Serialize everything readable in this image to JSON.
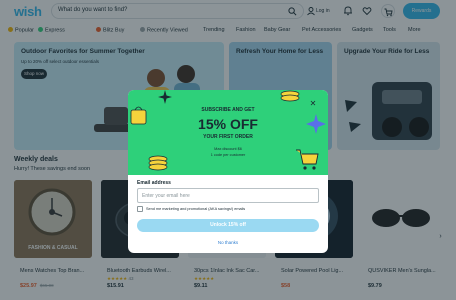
{
  "header": {
    "logo": "wish",
    "search_placeholder": "What do you want to find?",
    "login_label": "Log in",
    "wallet_label": "Rewards",
    "colors": {
      "brand": "#2fb7ec"
    }
  },
  "categories": [
    {
      "label": "Popular",
      "icon": "star-icon"
    },
    {
      "label": "Express",
      "icon": "lightning-icon"
    },
    {
      "label": "Blitz Buy",
      "icon": "flash-icon"
    },
    {
      "label": "Recently Viewed",
      "icon": "eye-icon"
    },
    {
      "label": "Trending",
      "icon": ""
    },
    {
      "label": "Fashion",
      "icon": ""
    },
    {
      "label": "Baby Gear",
      "icon": ""
    },
    {
      "label": "Pet Accessories",
      "icon": ""
    },
    {
      "label": "Gadgets",
      "icon": ""
    },
    {
      "label": "Tools",
      "icon": ""
    },
    {
      "label": "More",
      "icon": ""
    }
  ],
  "banners": [
    {
      "title": "Outdoor Favorites for Summer Together",
      "subtitle": "Up to 20% off select outdoor essentials",
      "button": "Shop now"
    },
    {
      "title": "Refresh Your Home for Less",
      "subtitle": "",
      "button": ""
    },
    {
      "title": "Upgrade Your Ride for Less",
      "subtitle": "",
      "button": ""
    }
  ],
  "weekly_deals": {
    "title": "Weekly deals",
    "subtitle": "Hurry! These savings end soon",
    "products": [
      {
        "name": "Mens Watches Top Bran...",
        "price": "$25.97",
        "old_price": "$65.00",
        "stars": "",
        "rating_count": "",
        "caption": "FASHION & CASUAL"
      },
      {
        "name": "Bluetooth Earbuds Wirel...",
        "price": "$15.91",
        "old_price": "",
        "stars": "★★★★★",
        "rating_count": "43",
        "caption": ""
      },
      {
        "name": "30pcs 1Inlac Ink Sac Car...",
        "price": "$9.11",
        "old_price": "",
        "stars": "★★★★★",
        "rating_count": "",
        "caption": ""
      },
      {
        "name": "Solar Powered Pool Lig...",
        "price": "$58",
        "old_price": "",
        "stars": "",
        "rating_count": "",
        "caption": ""
      },
      {
        "name": "QUSVIKER Men's Sungla...",
        "price": "$9.79",
        "old_price": "",
        "stars": "",
        "rating_count": "",
        "caption": ""
      }
    ]
  },
  "modal": {
    "eyebrow": "SUBSCRIBE AND GET",
    "headline": "15% OFF",
    "subheadline": "YOUR FIRST ORDER",
    "fine_print_1": "Max discount $6",
    "fine_print_2": "1 code per customer",
    "email_label": "Email address",
    "email_placeholder": "Enter your email here",
    "email_value": "",
    "consent_text": "Send me marketing and promotional (AKA savings!) emails",
    "unlock_button": "Unlock 15% off",
    "decline_link": "No thanks",
    "colors": {
      "top": "#2ed07a",
      "button": "#9ad9f2",
      "link": "#2f7ed0"
    }
  }
}
